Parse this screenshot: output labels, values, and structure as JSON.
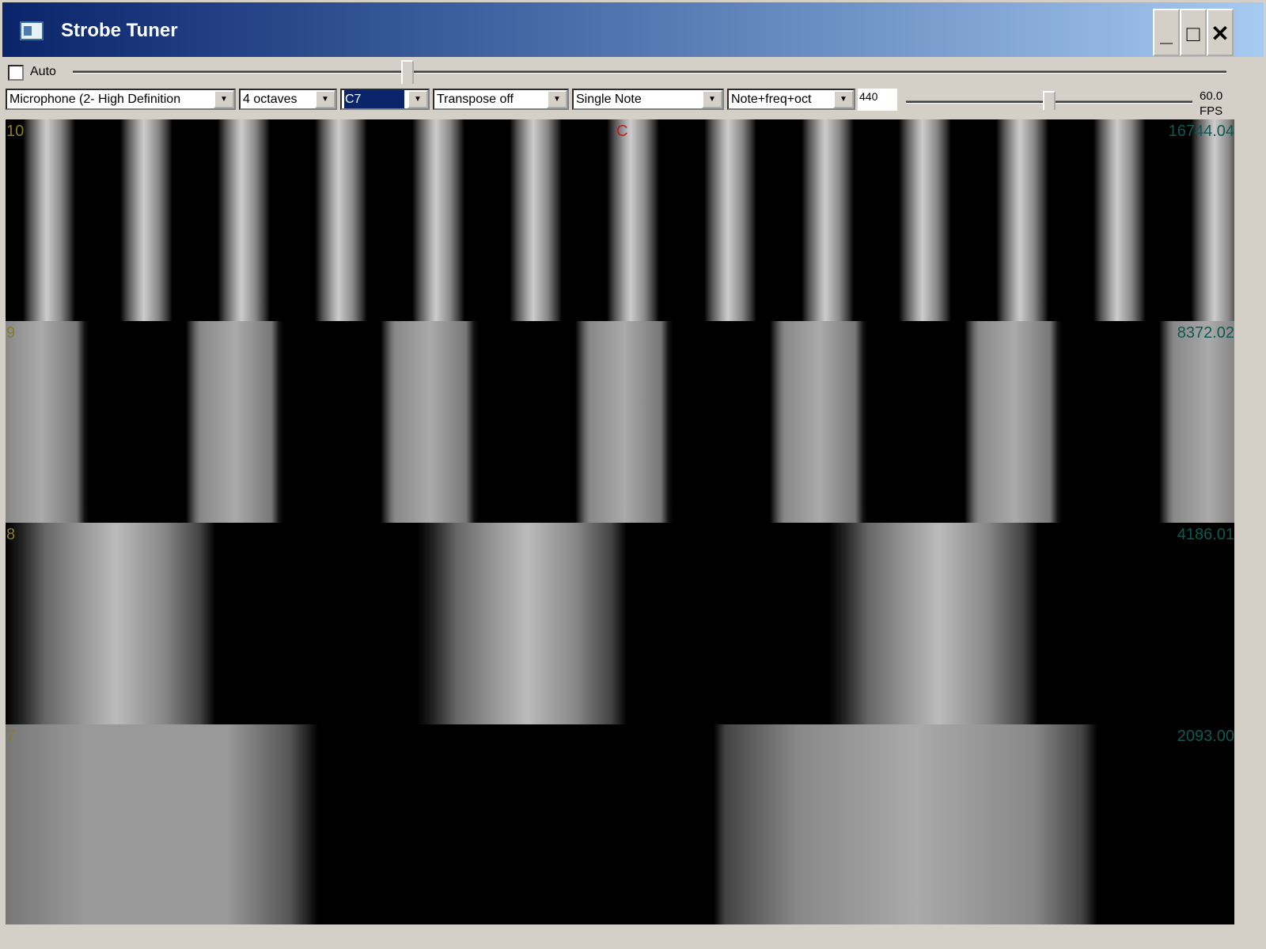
{
  "window": {
    "title": "Strobe Tuner",
    "minimize": "_",
    "maximize": "□",
    "close": "✕"
  },
  "toolbar": {
    "auto_label": "Auto",
    "auto_checked": false,
    "device": "Microphone (2- High Definition",
    "range": "4 octaves",
    "note": "C7",
    "transpose": "Transpose off",
    "mode": "Single Note",
    "display": "Note+freq+oct",
    "reference": "440",
    "fps_value": "60.0",
    "fps_unit": "FPS"
  },
  "strobe": {
    "note": "C",
    "bands": [
      {
        "octave": "10",
        "freq": "16744.04"
      },
      {
        "octave": "9",
        "freq": "8372.02"
      },
      {
        "octave": "8",
        "freq": "4186.01"
      },
      {
        "octave": "7",
        "freq": "2093.00"
      }
    ]
  },
  "colors": {
    "note": "#c02020",
    "octave": "#8a7a2a",
    "freq": "#0e5a50"
  }
}
